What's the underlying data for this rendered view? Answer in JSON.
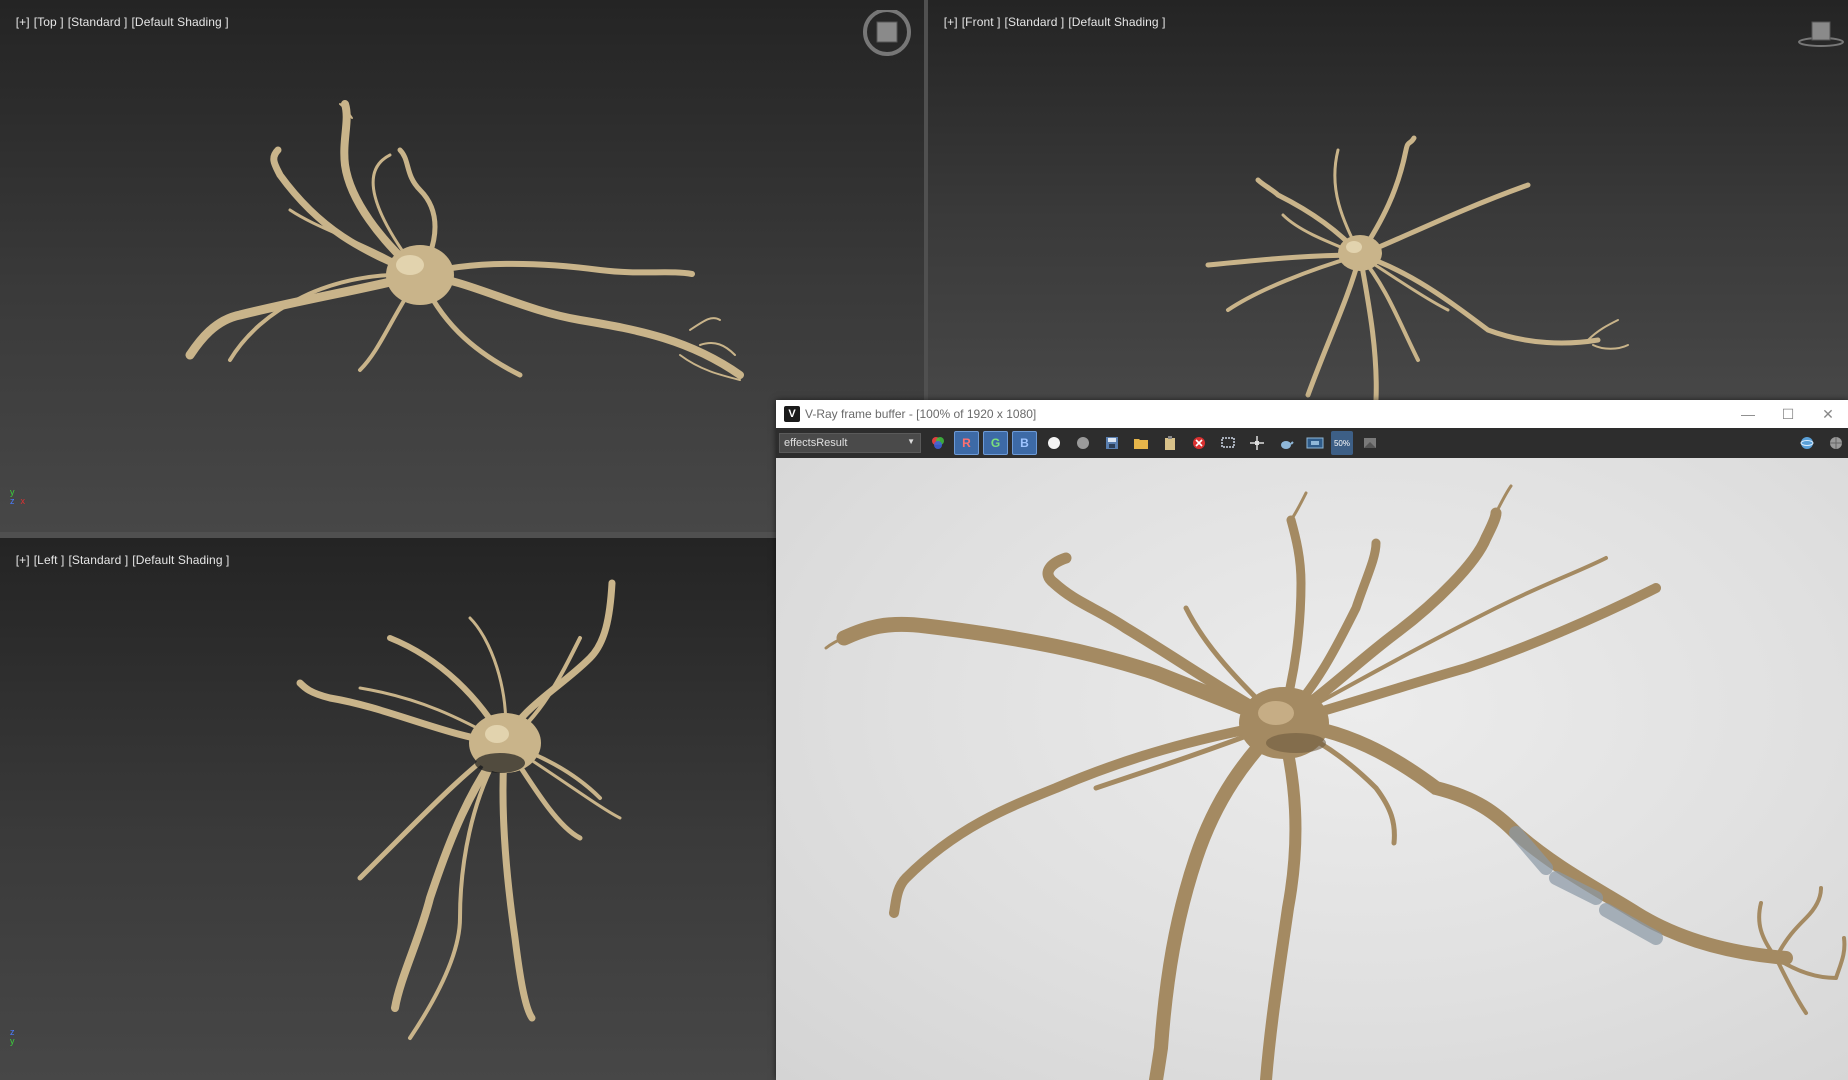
{
  "viewports": {
    "top": {
      "plus": "[+]",
      "view": "[Top ]",
      "mode": "[Standard ]",
      "shading": "[Default Shading ]"
    },
    "front": {
      "plus": "[+]",
      "view": "[Front ]",
      "mode": "[Standard ]",
      "shading": "[Default Shading ]"
    },
    "left": {
      "plus": "[+]",
      "view": "[Left ]",
      "mode": "[Standard ]",
      "shading": "[Default Shading ]"
    }
  },
  "axis_gizmo": {
    "y": "y",
    "z": "z",
    "x": "x"
  },
  "vfb": {
    "logo": "V",
    "title": "V-Ray frame buffer - [100% of 1920 x 1080]",
    "channel": "effectsResult",
    "window_buttons": {
      "minimize": "—",
      "maximize": "☐",
      "close": "✕"
    },
    "toolbar": {
      "r_label": "R",
      "g_label": "G",
      "b_label": "B",
      "icons": [
        "color-channels-icon",
        "white-circle-icon",
        "grey-circle-icon",
        "save-icon",
        "open-folder-icon",
        "clipboard-icon",
        "clear-icon",
        "region-render-icon",
        "track-mouse-icon",
        "teapot-render-icon",
        "lens-effects-icon",
        "zoom-50-icon",
        "history-icon",
        "globe-render-icon",
        "sphere-icon"
      ],
      "zoom_label": "50%"
    }
  },
  "colors": {
    "neuron": "#c9b48a",
    "neuron_dark": "#8a7452",
    "vfb_neuron": "#a48a62",
    "channel_btn": "#3d6aa6"
  }
}
